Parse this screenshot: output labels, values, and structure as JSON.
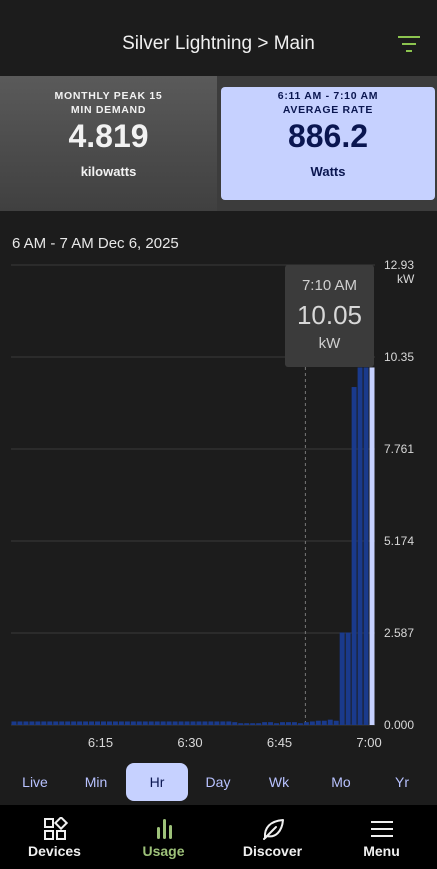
{
  "header": {
    "title": "Silver Lightning > Main",
    "filter_icon": "filter-icon",
    "accent_color": "#8cc44f"
  },
  "cards": {
    "left": {
      "label_line1": "MONTHLY PEAK 15",
      "label_line2": "MIN DEMAND",
      "value": "4.819",
      "unit": "kilowatts"
    },
    "right": {
      "label_line1": "6:11 AM - 7:10 AM",
      "label_line2": "AVERAGE RATE",
      "value": "886.2",
      "unit": "Watts",
      "background": "#c6d1ff"
    }
  },
  "chart": {
    "range_title": "6 AM - 7 AM Dec 6, 2025",
    "tooltip": {
      "time": "7:10 AM",
      "value": "10.05",
      "unit": "kW"
    }
  },
  "chart_data": {
    "type": "bar",
    "x_tick_labels": [
      "6:15",
      "6:30",
      "6:45",
      "7:00"
    ],
    "x_tick_minutes": [
      15,
      30,
      45,
      60
    ],
    "y_tick_labels": [
      "12.93",
      "10.35",
      "7.761",
      "5.174",
      "2.587",
      "0.000"
    ],
    "y_unit": "kW",
    "ylim": [
      0,
      12.93
    ],
    "xlim_minutes": [
      0,
      61
    ],
    "grid": true,
    "bar_color": "#1a3a8c",
    "highlight_color": "#c6d1ff",
    "minutes": [
      0,
      1,
      2,
      3,
      4,
      5,
      6,
      7,
      8,
      9,
      10,
      11,
      12,
      13,
      14,
      15,
      16,
      17,
      18,
      19,
      20,
      21,
      22,
      23,
      24,
      25,
      26,
      27,
      28,
      29,
      30,
      31,
      32,
      33,
      34,
      35,
      36,
      37,
      38,
      39,
      40,
      41,
      42,
      43,
      44,
      45,
      46,
      47,
      48,
      49,
      50,
      51,
      52,
      53,
      54,
      55,
      56,
      57,
      58,
      59,
      60
    ],
    "values": [
      0.1,
      0.1,
      0.1,
      0.1,
      0.1,
      0.1,
      0.1,
      0.1,
      0.1,
      0.1,
      0.1,
      0.1,
      0.1,
      0.1,
      0.1,
      0.1,
      0.1,
      0.1,
      0.1,
      0.1,
      0.1,
      0.1,
      0.1,
      0.1,
      0.1,
      0.1,
      0.1,
      0.1,
      0.1,
      0.1,
      0.1,
      0.1,
      0.1,
      0.1,
      0.1,
      0.1,
      0.1,
      0.08,
      0.05,
      0.05,
      0.05,
      0.05,
      0.08,
      0.08,
      0.05,
      0.08,
      0.08,
      0.08,
      0.05,
      0.08,
      0.1,
      0.12,
      0.12,
      0.15,
      0.12,
      2.6,
      2.6,
      9.5,
      10.05,
      10.05,
      10.05
    ],
    "selected_minute": 60,
    "hover_minute": 49
  },
  "periods": {
    "items": [
      "Live",
      "Min",
      "Hr",
      "Day",
      "Wk",
      "Mo",
      "Yr"
    ],
    "active_index": 2
  },
  "nav": {
    "items": [
      {
        "label": "Devices",
        "icon": "devices-icon"
      },
      {
        "label": "Usage",
        "icon": "usage-icon"
      },
      {
        "label": "Discover",
        "icon": "leaf-icon"
      },
      {
        "label": "Menu",
        "icon": "menu-icon"
      }
    ],
    "active_index": 1,
    "active_color": "#9ec27a"
  }
}
